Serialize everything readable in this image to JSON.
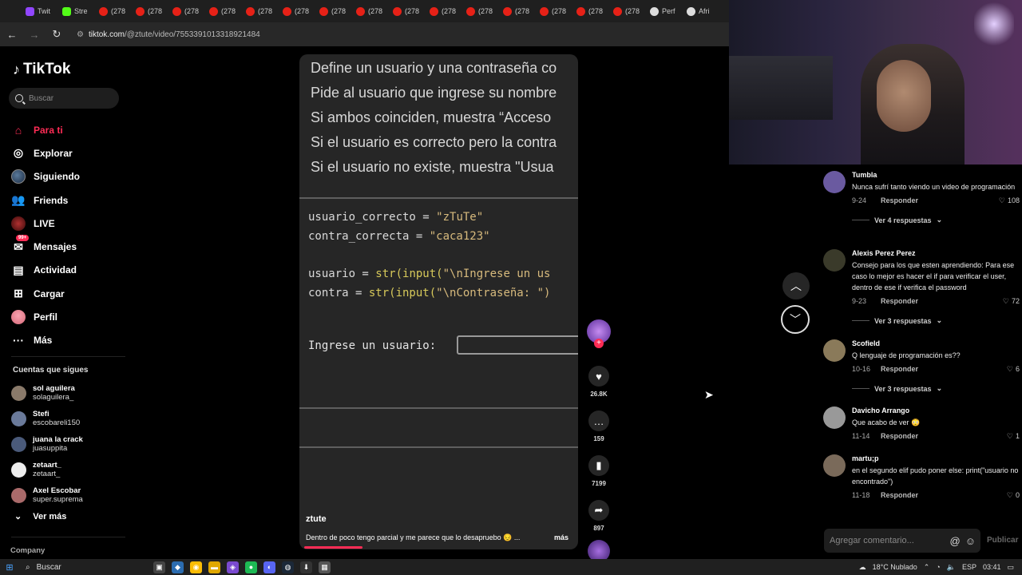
{
  "browser": {
    "tabs": [
      {
        "label": "Twit",
        "icon": "twitch-icon",
        "kind": "tw"
      },
      {
        "label": "Stre",
        "icon": "kick-icon",
        "kind": "kick"
      },
      {
        "label": "(278",
        "icon": "youtube-icon",
        "kind": "yt"
      },
      {
        "label": "(278",
        "icon": "youtube-icon",
        "kind": "yt"
      },
      {
        "label": "(278",
        "icon": "youtube-icon",
        "kind": "yt"
      },
      {
        "label": "(278",
        "icon": "youtube-icon",
        "kind": "yt"
      },
      {
        "label": "(278",
        "icon": "youtube-icon",
        "kind": "yt"
      },
      {
        "label": "(278",
        "icon": "youtube-icon",
        "kind": "yt"
      },
      {
        "label": "(278",
        "icon": "youtube-icon",
        "kind": "yt"
      },
      {
        "label": "(278",
        "icon": "youtube-icon",
        "kind": "yt"
      },
      {
        "label": "(278",
        "icon": "youtube-icon",
        "kind": "yt"
      },
      {
        "label": "(278",
        "icon": "youtube-icon",
        "kind": "yt"
      },
      {
        "label": "(278",
        "icon": "youtube-icon",
        "kind": "yt"
      },
      {
        "label": "(278",
        "icon": "youtube-icon",
        "kind": "yt"
      },
      {
        "label": "(278",
        "icon": "youtube-icon",
        "kind": "yt"
      },
      {
        "label": "(278",
        "icon": "youtube-icon",
        "kind": "yt"
      },
      {
        "label": "(278",
        "icon": "youtube-icon",
        "kind": "yt"
      },
      {
        "label": "Perf",
        "icon": "generic-icon",
        "kind": "gen"
      },
      {
        "label": "Afri",
        "icon": "generic-icon",
        "kind": "gen"
      }
    ],
    "url_host": "tiktok.com",
    "url_path": "/@ztute/video/7553391013318921484"
  },
  "sidebar": {
    "logo": "TikTok",
    "search_placeholder": "Buscar",
    "menu": [
      {
        "label": "Para ti",
        "icon": "home-icon",
        "glyph": "⌂",
        "active": true
      },
      {
        "label": "Explorar",
        "icon": "compass-icon",
        "glyph": "◎"
      },
      {
        "label": "Siguiendo",
        "icon": "following-avatar-icon",
        "glyph": "",
        "avatar": true
      },
      {
        "label": "Friends",
        "icon": "friends-icon",
        "glyph": "👥"
      },
      {
        "label": "LIVE",
        "icon": "live-icon",
        "glyph": "",
        "live": true
      },
      {
        "label": "Mensajes",
        "icon": "messages-icon",
        "glyph": "✉",
        "badge": "99+"
      },
      {
        "label": "Actividad",
        "icon": "activity-icon",
        "glyph": "▤"
      },
      {
        "label": "Cargar",
        "icon": "upload-icon",
        "glyph": "⊞"
      },
      {
        "label": "Perfil",
        "icon": "profile-avatar-icon",
        "glyph": "",
        "perfil": true
      },
      {
        "label": "Más",
        "icon": "more-icon",
        "glyph": "···"
      }
    ],
    "following_title": "Cuentas que sigues",
    "following": [
      {
        "name": "sol aguilera",
        "handle": "solaguilera_",
        "color": "#8a7a6a"
      },
      {
        "name": "Stefi",
        "handle": "escobareli150",
        "color": "#6a7a9a"
      },
      {
        "name": "juana la crack",
        "handle": "juasuppita",
        "color": "#4a5a7a"
      },
      {
        "name": "zetaart_",
        "handle": "zetaart_",
        "color": "#eeeeee"
      },
      {
        "name": "Axel Escobar",
        "handle": "super.suprema",
        "color": "#aa6a6a"
      }
    ],
    "see_more": "Ver más",
    "company": "Company"
  },
  "video": {
    "lines": [
      "Define un usuario y una contraseña co",
      "Pide al usuario que ingrese su nombre",
      "Si ambos coinciden, muestra “Acceso",
      "Si el usuario es correcto pero la contra",
      "Si el usuario no existe, muestra \"Usua"
    ],
    "code_line1_var": "usuario_correcto = ",
    "code_line1_str": "\"zTuTe\"",
    "code_line2_var": "contra_correcta = ",
    "code_line2_str": "\"caca123\"",
    "code_line3_var": "usuario = ",
    "code_line3_fn": "str(input(",
    "code_line3_str": "\"\\nIngrese un us",
    "code_line4_var": "contra = ",
    "code_line4_fn": "str(input(",
    "code_line4_str": "\"\\nContraseña: \")",
    "prompt": "Ingrese un usuario:",
    "author": "ztute",
    "description": "Dentro de poco tengo parcial y me parece que lo desapruebo 😔 ...",
    "more": "más",
    "progress": 0.21
  },
  "actions": {
    "likes": "26.8K",
    "comments": "159",
    "saves": "7199",
    "shares": "897"
  },
  "comments": [
    {
      "user": "Tumbla",
      "text": "Nunca sufrí tanto viendo un video de programación",
      "date": "9-24",
      "reply": "Responder",
      "likes": "108",
      "replies": "Ver 4 respuestas",
      "color": "#6a5aa0"
    },
    {
      "user": "Alexis Perez Perez",
      "text": "Consejo para los que esten aprendiendo: Para ese caso lo mejor es hacer el if para verificar el user, dentro de ese if verifica el password",
      "date": "9-23",
      "reply": "Responder",
      "likes": "72",
      "replies": "Ver 3 respuestas",
      "color": "#3a3a2a"
    },
    {
      "user": "Scofield",
      "text": "Q lenguaje de programación es??",
      "date": "10-16",
      "reply": "Responder",
      "likes": "6",
      "replies": "Ver 3 respuestas",
      "color": "#8a7a5a"
    },
    {
      "user": "Davicho Arrango",
      "text": "Que acabo de ver 😳",
      "date": "11-14",
      "reply": "Responder",
      "likes": "1",
      "replies": "",
      "color": "#999999"
    },
    {
      "user": "martu;p",
      "text": "en el segundo elif pudo poner else: print(\"usuario no encontrado\")",
      "date": "11-18",
      "reply": "Responder",
      "likes": "0",
      "replies": "",
      "color": "#7a6a5a"
    }
  ],
  "comment_input": {
    "placeholder": "Agregar comentario...",
    "publish": "Publicar"
  },
  "taskbar": {
    "search": "Buscar",
    "weather": "18°C Nublado",
    "lang": "ESP",
    "time": "03:41"
  }
}
